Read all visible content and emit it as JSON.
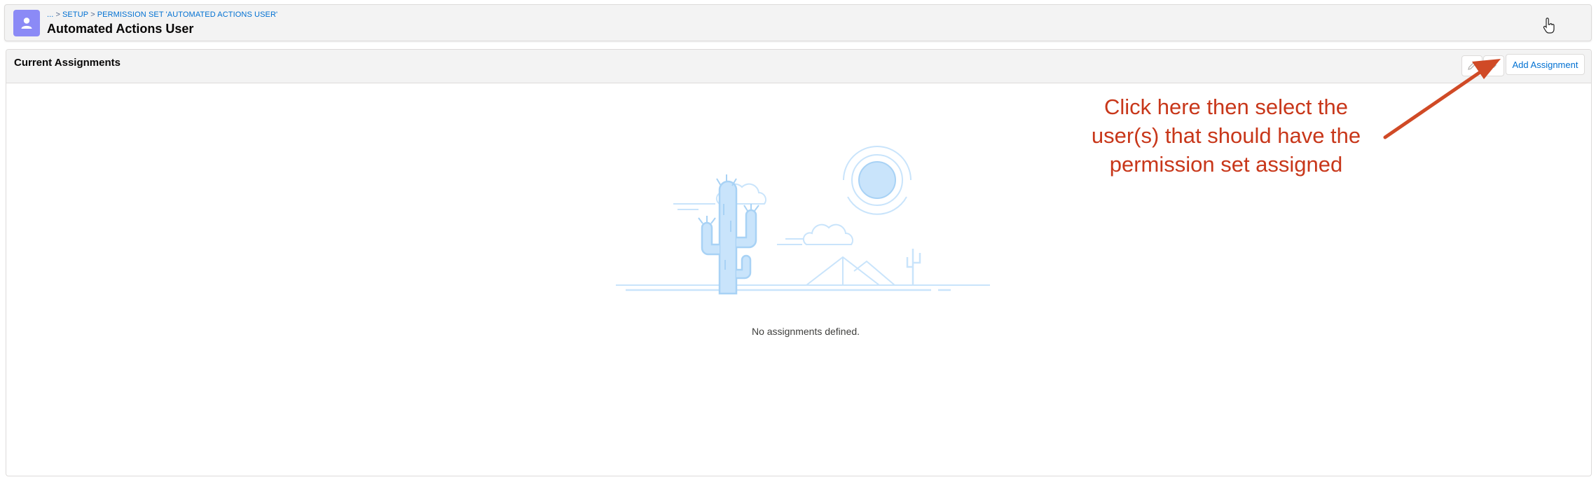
{
  "header": {
    "breadcrumb": [
      "...",
      "SETUP",
      "PERMISSION SET 'AUTOMATED ACTIONS USER'"
    ],
    "title": "Automated Actions User",
    "avatar_icon": "user-icon",
    "avatar_color": "#8b8af6"
  },
  "card": {
    "title": "Current Assignments",
    "edit_icon": "pencil-icon",
    "more_icon": "chevron-down-icon",
    "add_button_label": "Add Assignment",
    "empty_message": "No assignments defined.",
    "illustration": "desert-cactus-illustration"
  },
  "annotation": {
    "text_lines": [
      "Click here then select the",
      "user(s) that should have the",
      "permission set assigned"
    ],
    "color": "#c8371a",
    "arrow_icon": "arrow-icon"
  },
  "colors": {
    "link": "#0070d2",
    "header_bg": "#f3f3f3",
    "border": "#dddbda",
    "illustration_light": "#c9e4fb",
    "illustration_stroke": "#a8d2f5"
  }
}
